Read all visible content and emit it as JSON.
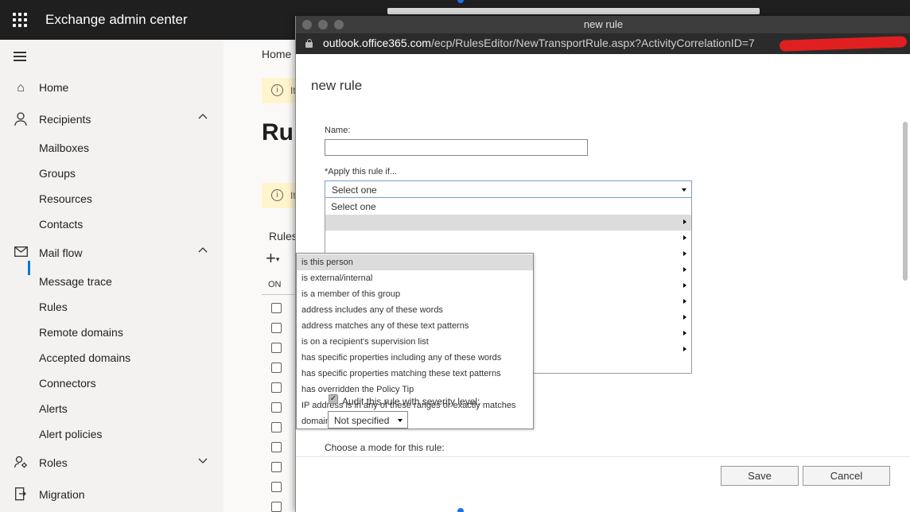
{
  "app": {
    "title": "Exchange admin center"
  },
  "sidebar": {
    "items": [
      {
        "label": "Home",
        "icon": "home-icon"
      },
      {
        "label": "Recipients",
        "icon": "person-icon",
        "expanded": true
      },
      {
        "label": "Mailboxes"
      },
      {
        "label": "Groups"
      },
      {
        "label": "Resources"
      },
      {
        "label": "Contacts"
      },
      {
        "label": "Mail flow",
        "icon": "mail-icon",
        "expanded": true
      },
      {
        "label": "Message trace"
      },
      {
        "label": "Rules",
        "selected": true
      },
      {
        "label": "Remote domains"
      },
      {
        "label": "Accepted domains"
      },
      {
        "label": "Connectors"
      },
      {
        "label": "Alerts"
      },
      {
        "label": "Alert policies"
      },
      {
        "label": "Roles",
        "icon": "roles-icon",
        "expanded": false
      },
      {
        "label": "Migration",
        "icon": "migration-icon"
      }
    ]
  },
  "main": {
    "breadcrumb": "Home",
    "banner_text": "It",
    "title": "Rul",
    "rules_label": "Rules",
    "col_on": "ON"
  },
  "popup": {
    "window_title": "new rule",
    "url_host": "outlook.office365.com",
    "url_path": "/ecp/RulesEditor/NewTransportRule.aspx?ActivityCorrelationID=7",
    "heading": "new rule",
    "name_label": "Name:",
    "name_value": "",
    "apply_label": "*Apply this rule if...",
    "apply_selected": "Select one",
    "apply_options_first": "Select one",
    "submenu": [
      "is this person",
      "is external/internal",
      "is a member of this group",
      "address includes any of these words",
      "address matches any of these text patterns",
      "is on a recipient's supervision list",
      "has specific properties including any of these words",
      "has specific properties matching these text patterns",
      "has overridden the Policy Tip",
      "IP address is in any of these ranges or exactly matches",
      "domain is"
    ],
    "audit_label": "Audit this rule with severity level:",
    "audit_checked": true,
    "severity": "Not specified",
    "mode_label": "Choose a mode for this rule:",
    "save": "Save",
    "cancel": "Cancel"
  },
  "colors": {
    "accent": "#0078d4",
    "topbar": "#1f1f1f",
    "banner": "#fff4ce"
  }
}
